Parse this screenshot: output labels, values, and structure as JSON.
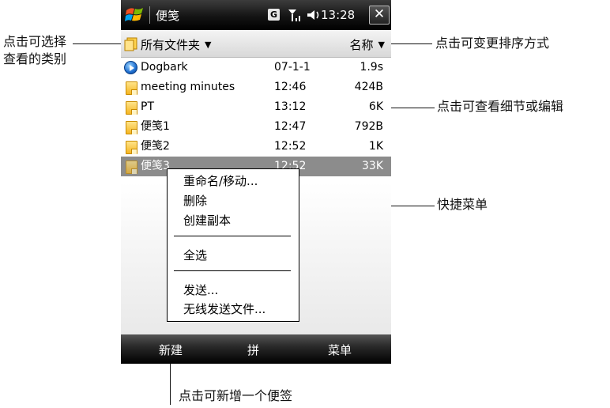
{
  "titlebar": {
    "app_title": "便笺",
    "network_badge": "G",
    "time": "13:28",
    "close_label": "✕"
  },
  "header": {
    "folder_label": "所有文件夹",
    "sort_label": "名称"
  },
  "files": [
    {
      "name": "Dogbark",
      "date": "07-1-1",
      "size": "1.9s",
      "icon": "media-file-icon"
    },
    {
      "name": "meeting minutes",
      "date": "12:46",
      "size": "424B",
      "icon": "note-icon"
    },
    {
      "name": "PT",
      "date": "13:12",
      "size": "6K",
      "icon": "note-icon"
    },
    {
      "name": "便笺1",
      "date": "12:47",
      "size": "792B",
      "icon": "note-icon"
    },
    {
      "name": "便笺2",
      "date": "12:52",
      "size": "1K",
      "icon": "note-icon"
    },
    {
      "name": "便笺3",
      "date": "12:52",
      "size": "33K",
      "icon": "note-icon",
      "selected": true
    }
  ],
  "context_menu": {
    "rename_move": "重命名/移动...",
    "delete": "删除",
    "copy": "创建副本",
    "select_all": "全选",
    "send": "发送...",
    "beam": "无线发送文件..."
  },
  "softkeys": {
    "left": "新建",
    "center": "拼",
    "right": "菜单"
  },
  "callouts": {
    "folder_line1": "点击可选择",
    "folder_line2": "查看的类别",
    "sort": "点击可变更排序方式",
    "details": "点击可查看细节或编辑",
    "context_menu": "快捷菜单",
    "new": "点击可新增一个便签"
  },
  "colors": {
    "selection": "#8c8c8c",
    "titlebar": "#141414",
    "softkey_bar": "#000000"
  }
}
